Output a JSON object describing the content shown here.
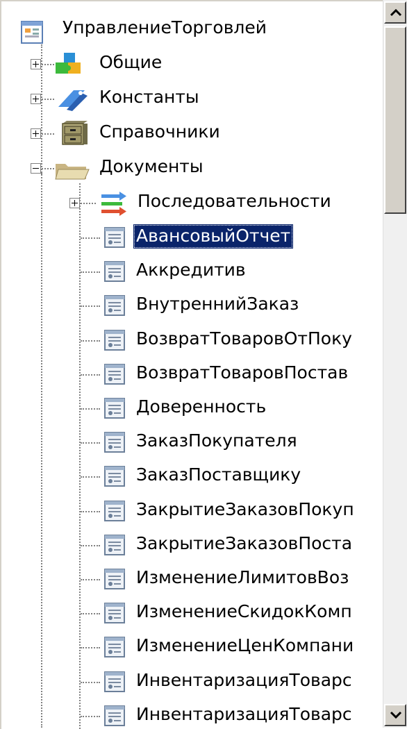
{
  "tree": {
    "root": {
      "label": "УправлениеТорговлей",
      "icon": "configuration-icon"
    },
    "groups": [
      {
        "label": "Общие",
        "icon": "common-puzzle-icon",
        "expanded": false
      },
      {
        "label": "Константы",
        "icon": "constants-icon",
        "expanded": false
      },
      {
        "label": "Справочники",
        "icon": "catalogs-cabinet-icon",
        "expanded": false
      },
      {
        "label": "Документы",
        "icon": "documents-folder-icon",
        "expanded": true
      }
    ],
    "documents_subgroup": {
      "label": "Последовательности",
      "icon": "sequences-icon",
      "expanded": false
    },
    "documents": [
      "АвансовыйОтчет",
      "Аккредитив",
      "ВнутреннийЗаказ",
      "ВозвратТоваровОтПоку",
      "ВозвратТоваровПостав",
      "Доверенность",
      "ЗаказПокупателя",
      "ЗаказПоставщику",
      "ЗакрытиеЗаказовПокуп",
      "ЗакрытиеЗаказовПоста",
      "ИзменениеЛимитовВоз",
      "ИзменениеСкидокКомп",
      "ИзменениеЦенКомпани",
      "ИнвентаризацияТоварс",
      "ИнвентаризацияТоварс"
    ],
    "selected_document": "АвансовыйОтчет"
  },
  "colors": {
    "selection": "#0a246a",
    "window_bg": "#ffffff",
    "chrome": "#d4d0c8"
  }
}
